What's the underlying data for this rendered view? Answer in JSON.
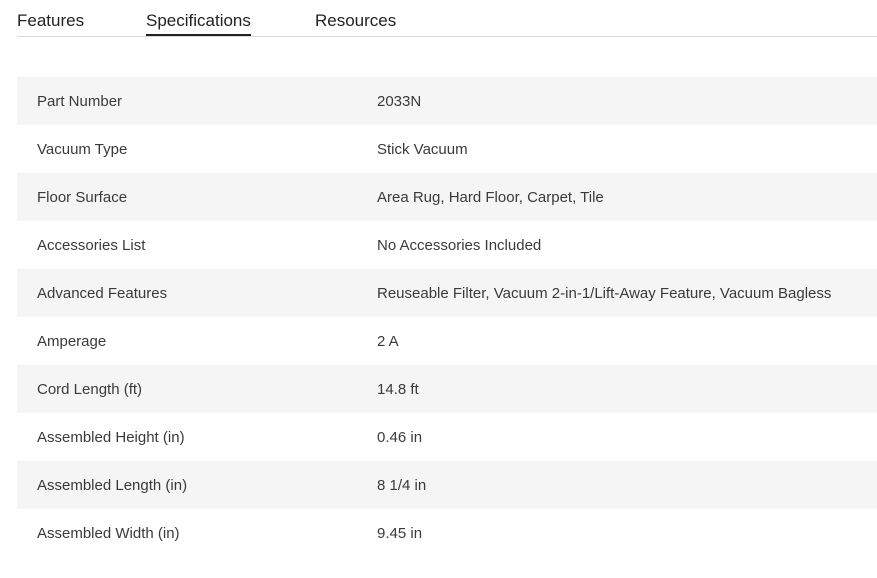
{
  "tabs": [
    {
      "label": "Features",
      "active": false
    },
    {
      "label": "Specifications",
      "active": true
    },
    {
      "label": "Resources",
      "active": false
    }
  ],
  "specs": [
    {
      "label": "Part Number",
      "value": "2033N"
    },
    {
      "label": "Vacuum Type",
      "value": "Stick Vacuum"
    },
    {
      "label": "Floor Surface",
      "value": "Area Rug, Hard Floor, Carpet, Tile"
    },
    {
      "label": "Accessories List",
      "value": "No Accessories Included"
    },
    {
      "label": "Advanced Features",
      "value": "Reuseable Filter, Vacuum 2-in-1/Lift-Away Feature, Vacuum Bagless"
    },
    {
      "label": "Amperage",
      "value": "2 A"
    },
    {
      "label": "Cord Length (ft)",
      "value": "14.8 ft"
    },
    {
      "label": "Assembled Height (in)",
      "value": "0.46 in"
    },
    {
      "label": "Assembled Length (in)",
      "value": "8 1/4 in"
    },
    {
      "label": "Assembled Width (in)",
      "value": "9.45 in"
    }
  ]
}
